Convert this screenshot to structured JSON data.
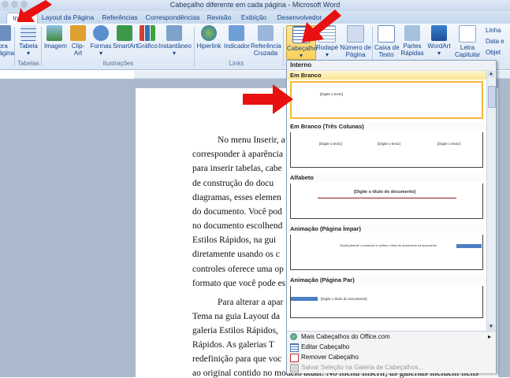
{
  "window": {
    "title": "Cabeçalho diferente em cada página - Microsoft Word"
  },
  "tabs": [
    {
      "label": "Inserir",
      "active": true
    },
    {
      "label": "Layout da Página"
    },
    {
      "label": "Referências"
    },
    {
      "label": "Correspondências"
    },
    {
      "label": "Revisão"
    },
    {
      "label": "Exibição"
    },
    {
      "label": "Desenvolvedor"
    }
  ],
  "ribbon": {
    "buttons": [
      {
        "label": "bra\npágina",
        "icon": "cover-page-icon"
      },
      {
        "label": "Tabela",
        "icon": "table-icon"
      },
      {
        "label": "Imagem",
        "icon": "image-icon"
      },
      {
        "label": "Clip-Art",
        "icon": "clipart-icon"
      },
      {
        "label": "Formas",
        "icon": "shapes-icon"
      },
      {
        "label": "SmartArt",
        "icon": "smartart-icon"
      },
      {
        "label": "Gráfico",
        "icon": "chart-icon"
      },
      {
        "label": "Instantâneo",
        "icon": "screenshot-icon"
      },
      {
        "label": "Hiperlink",
        "icon": "hyperlink-icon"
      },
      {
        "label": "Indicador",
        "icon": "bookmark-icon"
      },
      {
        "label": "Referência\nCruzada",
        "icon": "cross-reference-icon"
      },
      {
        "label": "Cabeçalho",
        "icon": "header-icon",
        "selected": true
      },
      {
        "label": "Rodapé",
        "icon": "footer-icon"
      },
      {
        "label": "Número de\nPágina",
        "icon": "page-number-icon"
      },
      {
        "label": "Caixa de\nTexto",
        "icon": "textbox-icon"
      },
      {
        "label": "Partes\nRápidas",
        "icon": "quick-parts-icon"
      },
      {
        "label": "WordArt",
        "icon": "wordart-icon"
      },
      {
        "label": "Letra\nCapitular",
        "icon": "dropcap-icon"
      }
    ],
    "groups": [
      "Tabelas",
      "Ilustrações",
      "Links"
    ],
    "small_items": [
      "Linha",
      "Data e",
      "Objet"
    ]
  },
  "document": {
    "lines": [
      "No menu Inserir, a",
      "corresponder à aparência",
      "para inserir tabelas, cabe",
      "de construção do docu",
      "diagramas, esses elemen",
      "do documento. Você pod",
      "no documento escolhend",
      "Estilos Rápidos, na gui",
      "diretamente usando os c",
      "controles oferece uma op",
      "formato que você pode es",
      "Para alterar a apar",
      "Tema na guia Layout da",
      "galeria Estilos Rápidos,",
      "Rápidos. As galerias T",
      "redefinição para que voc",
      "ao original contido no modelo atual. No menu Inserir, as galerias incluem itens"
    ]
  },
  "gallery": {
    "header": "Interno",
    "sections": [
      {
        "title": "Em Branco",
        "placeholders": [
          "[Digite o texto]"
        ],
        "hot": true
      },
      {
        "title": "Em Branco (Três Colunas)",
        "placeholders": [
          "[Digite o texto]",
          "[Digite o texto]",
          "[Digite o texto]"
        ]
      },
      {
        "title": "Alfabeto",
        "placeholders": [
          "[Digite o título do documento]"
        ]
      },
      {
        "title": "Animação (Página Ímpar)",
        "placeholders": [
          "Seção] Aborde o conteúdo e confira o título do documento na documento"
        ]
      },
      {
        "title": "Animação (Página Par)",
        "placeholders": [
          "[Digite o título do documento]"
        ]
      }
    ],
    "menu": [
      {
        "label": "Mais Cabeçalhos do Office.com",
        "icon": "office-online-icon",
        "disabled": false
      },
      {
        "label": "Editar Cabeçalho",
        "icon": "edit-header-icon",
        "disabled": false
      },
      {
        "label": "Remover Cabeçalho",
        "icon": "remove-header-icon",
        "disabled": false
      },
      {
        "label": "Salvar Seleção na Galeria de Cabeçalhos...",
        "icon": "save-selection-icon",
        "disabled": true
      }
    ]
  },
  "colors": {
    "accent": "#fbd15a",
    "annotation": "#e81010",
    "ribbon": "#dbe7f5"
  }
}
